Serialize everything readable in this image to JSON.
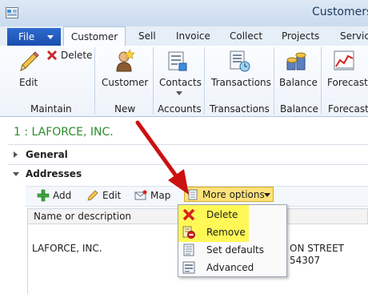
{
  "window": {
    "title": "Customers"
  },
  "tabs": {
    "file": "File",
    "items": [
      "Customer",
      "Sell",
      "Invoice",
      "Collect",
      "Projects",
      "Service"
    ]
  },
  "ribbon": {
    "maintain": {
      "edit": "Edit",
      "delete": "Delete",
      "group": "Maintain"
    },
    "new": {
      "customer": "Customer",
      "group": "New"
    },
    "accounts": {
      "contacts": "Contacts",
      "group": "Accounts"
    },
    "transactions": {
      "transactions": "Transactions",
      "group": "Transactions"
    },
    "balance": {
      "balance": "Balance",
      "group": "Balance"
    },
    "forecast": {
      "forecast": "Forecast",
      "group": "Forecast"
    }
  },
  "record": {
    "title": "1 : LAFORCE, INC."
  },
  "fasttabs": {
    "general": "General",
    "addresses": "Addresses"
  },
  "addresses_toolbar": {
    "add": "Add",
    "edit": "Edit",
    "map": "Map",
    "more_options": "More options"
  },
  "grid": {
    "header": "Name or description",
    "row": {
      "name": "LAFORCE, INC.",
      "addr_line1": "ON STREET",
      "addr_line2": "54307"
    }
  },
  "more_options_menu": {
    "items": [
      "Delete",
      "Remove",
      "Set defaults",
      "Advanced"
    ]
  },
  "colors": {
    "record_title": "#2e8b2e",
    "highlight": "#fff73a",
    "arrow": "#cc1111",
    "file_tab": "#2a62c5"
  }
}
